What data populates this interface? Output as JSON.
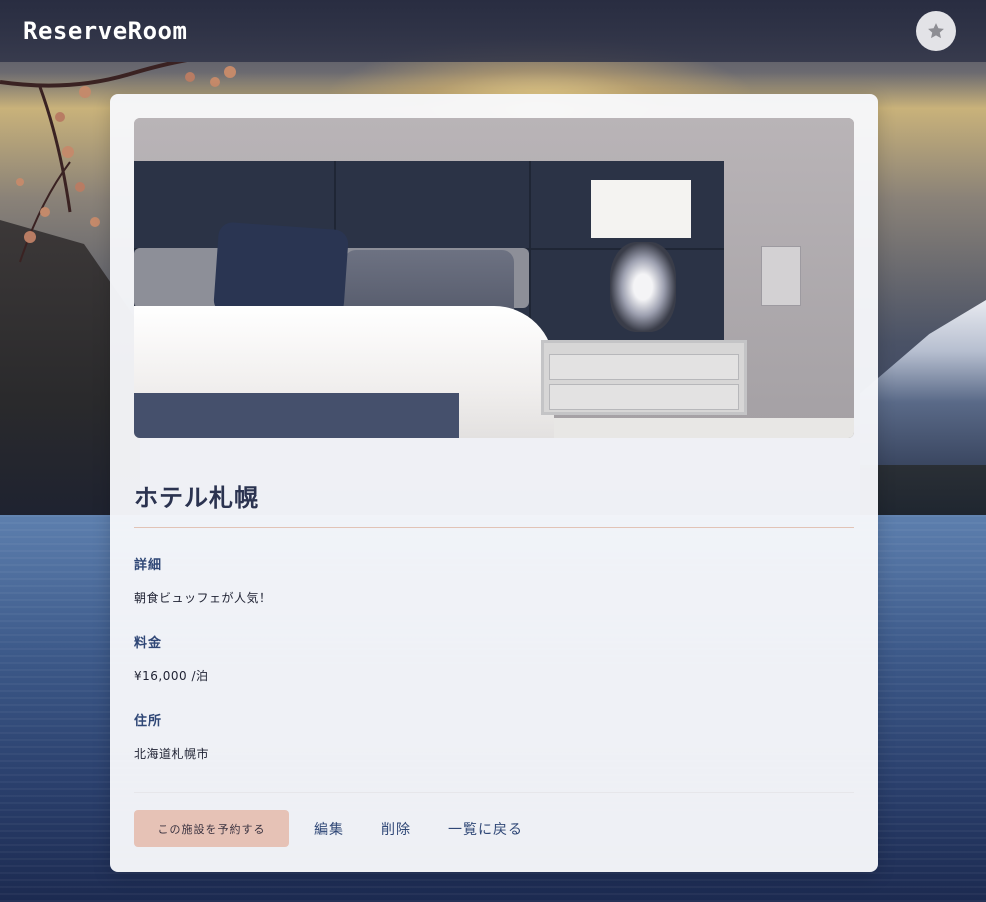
{
  "header": {
    "brand": "ReserveRoom",
    "favorite_icon": "star-icon"
  },
  "hotel": {
    "name": "ホテル札幌",
    "details_label": "詳細",
    "details_value": "朝食ビュッフェが人気！",
    "price_label": "料金",
    "price_value": "¥16,000 /泊",
    "address_label": "住所",
    "address_value": "北海道札幌市"
  },
  "actions": {
    "reserve_label": "この施設を予約する",
    "edit_label": "編集",
    "delete_label": "削除",
    "back_label": "一覧に戻る"
  },
  "colors": {
    "accent": "#2f4776",
    "reserve_button": "#e6c2b6",
    "header_bg": "#2e3248"
  }
}
